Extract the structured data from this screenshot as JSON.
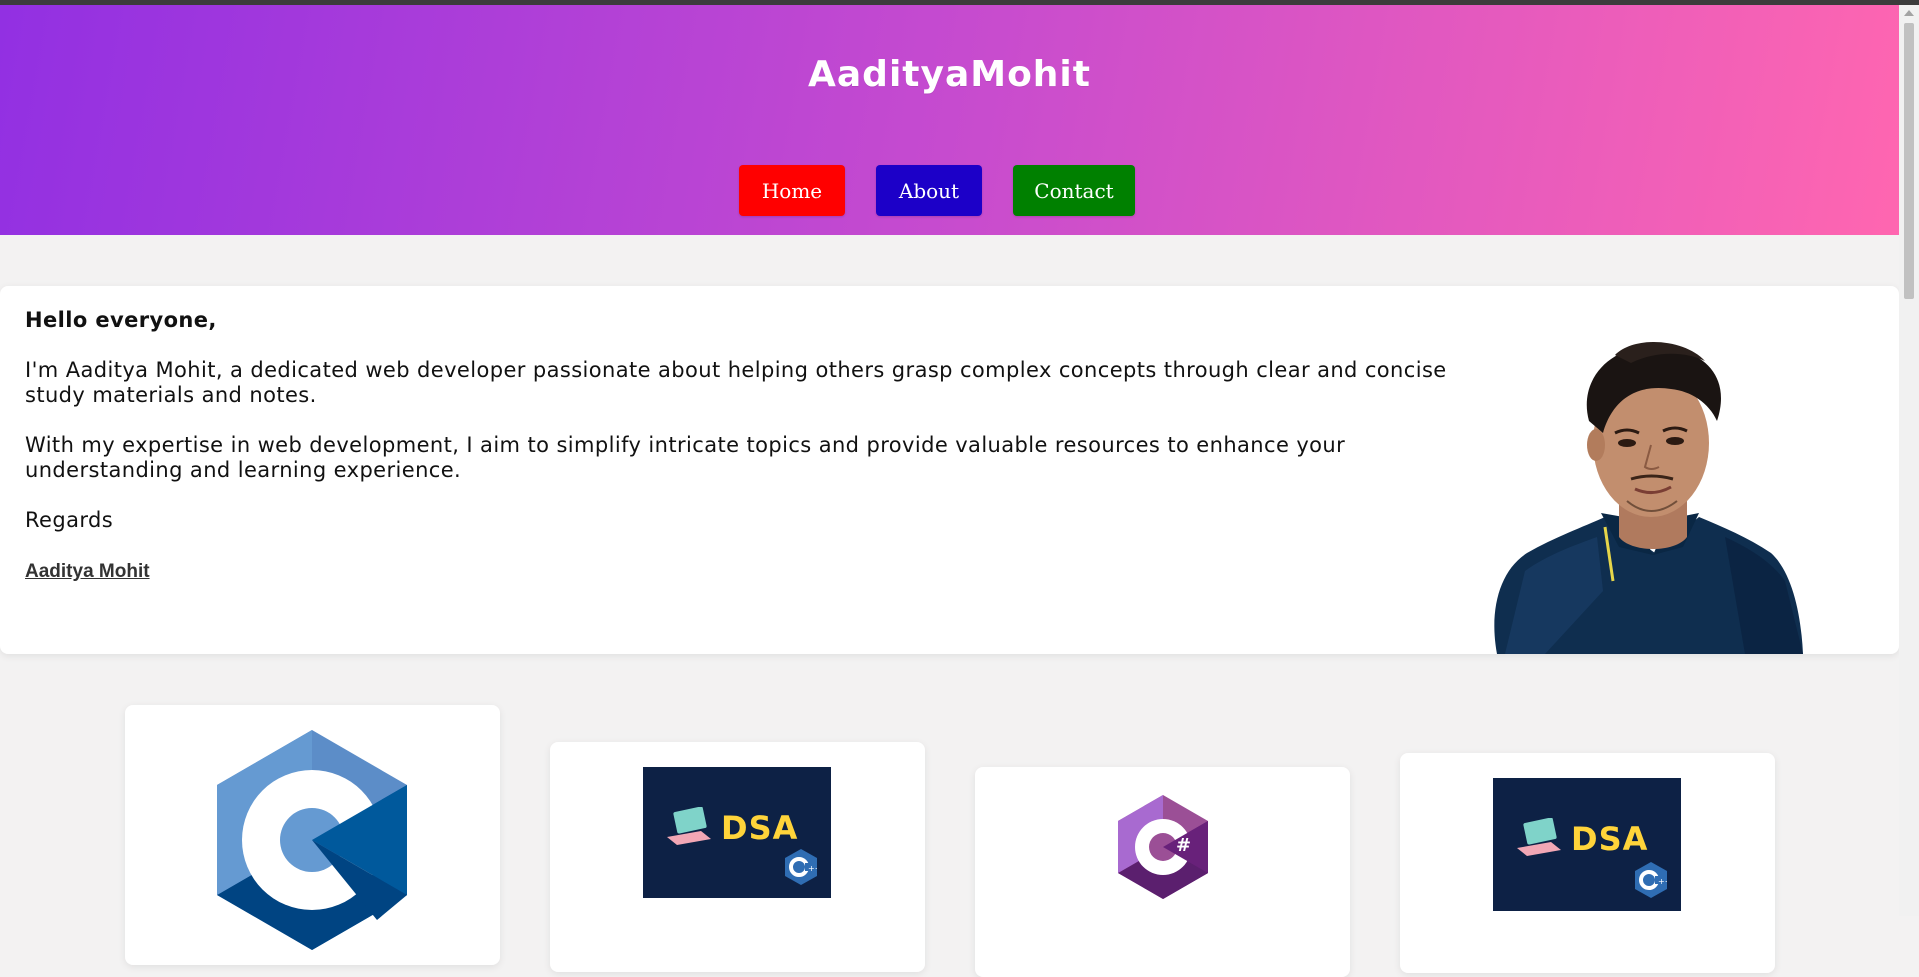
{
  "header": {
    "site_title": "AadityaMohit",
    "gradient_start": "#9230e2",
    "gradient_end": "#ff66b0"
  },
  "nav": {
    "items": [
      {
        "label": "Home",
        "color": "#ff0000"
      },
      {
        "label": "About",
        "color": "#1c00c8"
      },
      {
        "label": "Contact",
        "color": "#008000"
      }
    ]
  },
  "intro": {
    "greeting": "Hello everyone,",
    "paragraph_1": "I'm Aaditya Mohit, a dedicated web developer passionate about helping others grasp complex concepts through clear and concise study materials and notes.",
    "paragraph_2": "With my expertise in web development, I aim to simplify intricate topics and provide valuable resources to enhance your understanding and learning experience.",
    "closing": "Regards",
    "signature": "Aaditya Mohit"
  },
  "courses": [
    {
      "icon": "c-language-logo"
    },
    {
      "icon": "dsa-cpp-thumbnail",
      "label": "DSA"
    },
    {
      "icon": "csharp-logo"
    },
    {
      "icon": "dsa-cpp-thumbnail",
      "label": "DSA"
    }
  ]
}
